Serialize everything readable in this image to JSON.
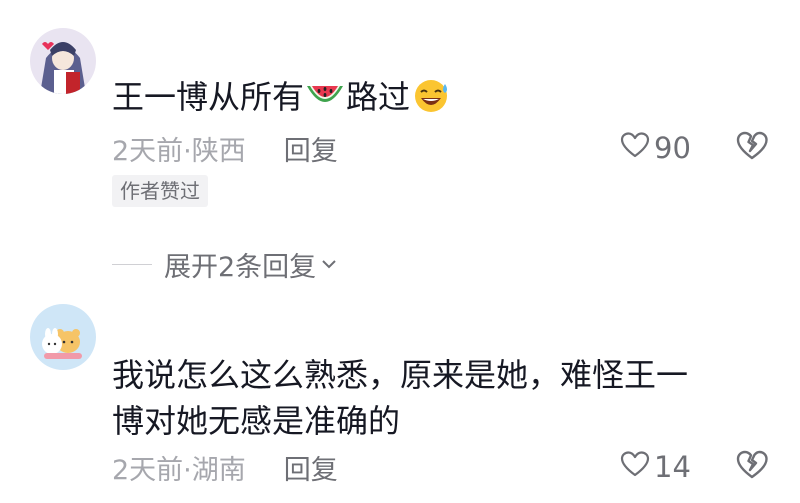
{
  "comments": [
    {
      "text_before": "王一博从所有",
      "emoji_1": "watermelon-emoji",
      "text_after": "路过",
      "emoji_2": "grinning-sweat-emoji",
      "time": "2天前·陕西",
      "reply": "回复",
      "likes": "90",
      "author_badge": "作者赞过",
      "expand": "展开2条回复"
    },
    {
      "line1": "我说怎么这么熟悉，原来是她，难怪王一",
      "line2": "博对她无感是准确的",
      "time": "2天前·湖南",
      "reply": "回复",
      "likes": "14"
    }
  ],
  "colors": {
    "text": "#161823",
    "meta": "#a6a7ad",
    "secondary": "#6e6f75",
    "badge_bg": "#f2f2f4",
    "avatar2_bg": "#cfe6f7"
  },
  "icons": [
    "heart-outline-icon",
    "broken-heart-icon",
    "chevron-down-icon"
  ]
}
